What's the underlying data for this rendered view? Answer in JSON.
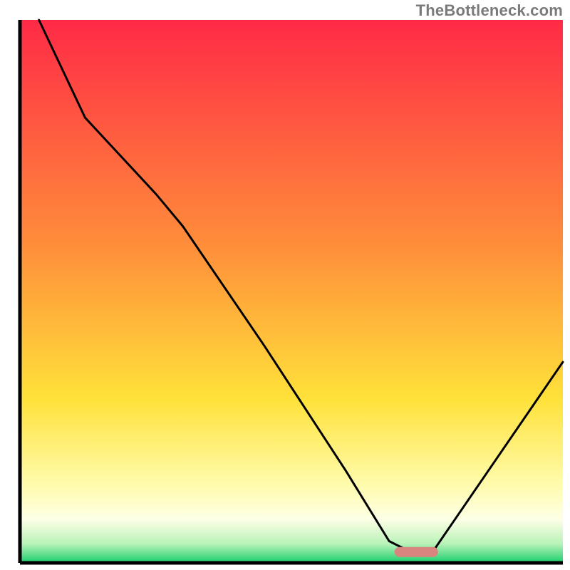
{
  "watermark": "TheBottleneck.com",
  "chart_data": {
    "type": "line",
    "title": "",
    "xlabel": "",
    "ylabel": "",
    "xlim": [
      0,
      100
    ],
    "ylim": [
      0,
      100
    ],
    "grid": false,
    "legend": false,
    "background_gradient_stops": [
      {
        "offset": 0,
        "color": "#ff2a46"
      },
      {
        "offset": 0.42,
        "color": "#ff8f3a"
      },
      {
        "offset": 0.7,
        "color": "#ffe23a"
      },
      {
        "offset": 0.86,
        "color": "#fffcb0"
      },
      {
        "offset": 0.92,
        "color": "#fdffe6"
      },
      {
        "offset": 0.965,
        "color": "#b8f2b8"
      },
      {
        "offset": 1.0,
        "color": "#18cf6b"
      }
    ],
    "series": [
      {
        "name": "bottleneck-curve",
        "color": "#000000",
        "x": [
          3.5,
          12,
          25,
          30,
          45,
          60,
          68,
          72,
          76,
          100
        ],
        "y": [
          100,
          82,
          68,
          62,
          40,
          17,
          4,
          2,
          2,
          37
        ]
      }
    ],
    "optimum_marker": {
      "x_range": [
        69,
        77
      ],
      "y": 2,
      "color": "#d9857f"
    }
  }
}
